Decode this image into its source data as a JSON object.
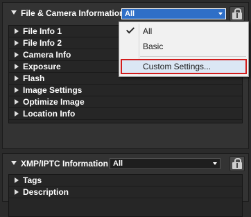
{
  "file_panel": {
    "title": "File & Camera Information",
    "dropdown_value": "All",
    "items": [
      {
        "label": "File Info 1"
      },
      {
        "label": "File Info 2"
      },
      {
        "label": "Camera Info"
      },
      {
        "label": "Exposure"
      },
      {
        "label": "Flash"
      },
      {
        "label": "Image Settings"
      },
      {
        "label": "Optimize Image"
      },
      {
        "label": "Location Info"
      }
    ]
  },
  "dropdown_menu": {
    "items": [
      {
        "label": "All",
        "checked": true
      },
      {
        "label": "Basic",
        "checked": false
      },
      {
        "label": "Custom Settings...",
        "checked": false,
        "highlighted": true
      }
    ]
  },
  "xmp_panel": {
    "title": "XMP/IPTC Information",
    "dropdown_value": "All",
    "items": [
      {
        "label": "Tags"
      },
      {
        "label": "Description"
      }
    ]
  },
  "colors": {
    "panel_bg": "#333333",
    "dropdown_selected": "#2f6fc7",
    "menu_bg": "#f1f1f1",
    "highlight_border": "#d21c1c"
  },
  "icons": [
    "collapse-arrow-icon",
    "expand-arrow-icon",
    "lock-info-icon",
    "checkmark-icon"
  ]
}
